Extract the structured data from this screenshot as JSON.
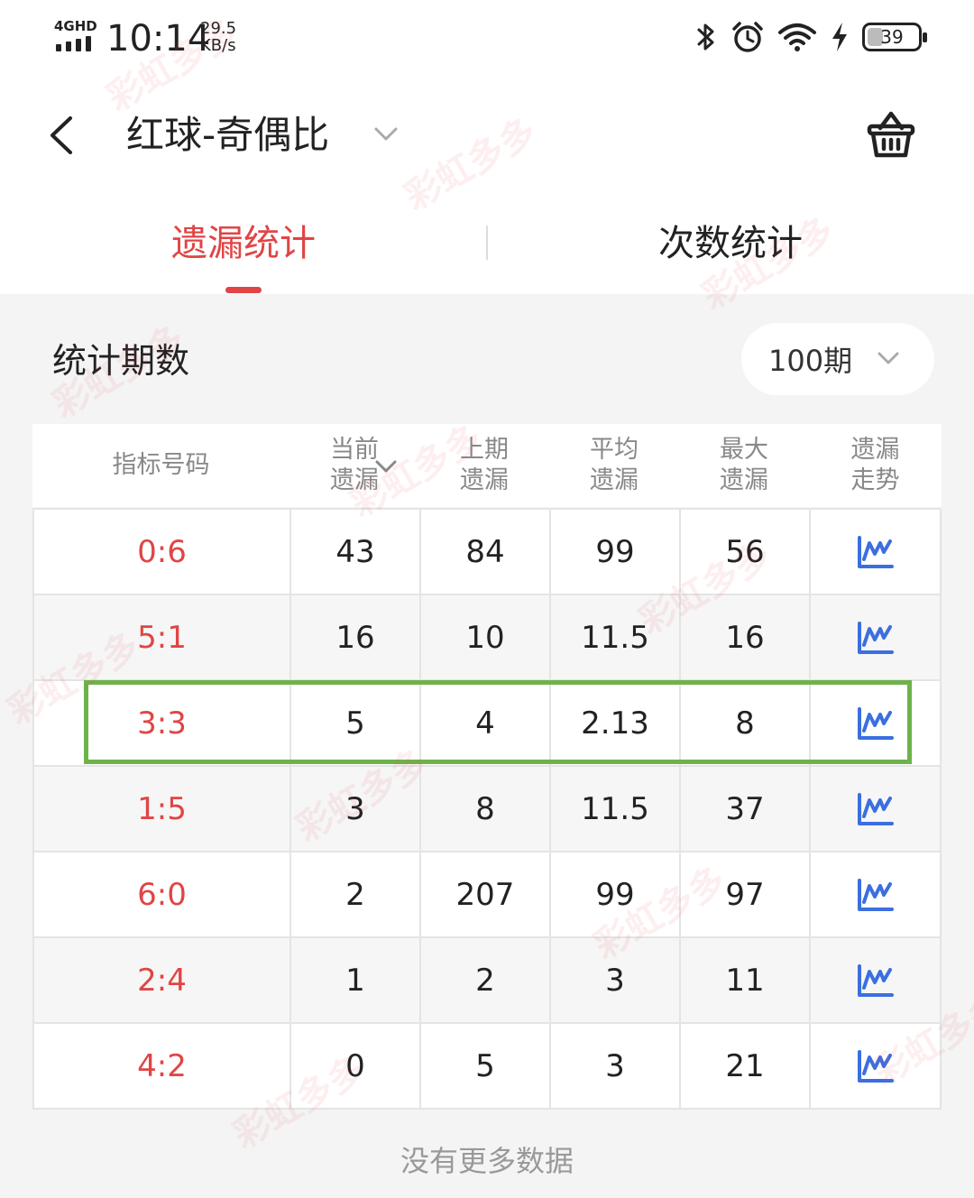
{
  "status_bar": {
    "network": "4GHD",
    "time": "10:14",
    "speed_value": "29.5",
    "speed_unit": "KB/s",
    "battery": "39"
  },
  "header": {
    "title": "红球-奇偶比"
  },
  "tabs": [
    {
      "label": "遗漏统计",
      "active": true
    },
    {
      "label": "次数统计",
      "active": false
    }
  ],
  "filter": {
    "label": "统计期数",
    "selected": "100期"
  },
  "table": {
    "columns": [
      {
        "line1": "指标号码",
        "line2": ""
      },
      {
        "line1": "当前",
        "line2": "遗漏"
      },
      {
        "line1": "上期",
        "line2": "遗漏"
      },
      {
        "line1": "平均",
        "line2": "遗漏"
      },
      {
        "line1": "最大",
        "line2": "遗漏"
      },
      {
        "line1": "遗漏",
        "line2": "走势"
      }
    ],
    "rows": [
      {
        "code": "0:6",
        "current": "43",
        "previous": "84",
        "average": "99",
        "max": "56"
      },
      {
        "code": "5:1",
        "current": "16",
        "previous": "10",
        "average": "11.5",
        "max": "16"
      },
      {
        "code": "3:3",
        "current": "5",
        "previous": "4",
        "average": "2.13",
        "max": "8"
      },
      {
        "code": "1:5",
        "current": "3",
        "previous": "8",
        "average": "11.5",
        "max": "37"
      },
      {
        "code": "6:0",
        "current": "2",
        "previous": "207",
        "average": "99",
        "max": "97"
      },
      {
        "code": "2:4",
        "current": "1",
        "previous": "2",
        "average": "3",
        "max": "11"
      },
      {
        "code": "4:2",
        "current": "0",
        "previous": "5",
        "average": "3",
        "max": "21"
      }
    ]
  },
  "footer": {
    "no_more": "没有更多数据"
  },
  "watermark": "彩虹多多",
  "colors": {
    "accent_red": "#e04545",
    "trend_blue": "#3b6fe0",
    "highlight_green": "#6db34a"
  }
}
